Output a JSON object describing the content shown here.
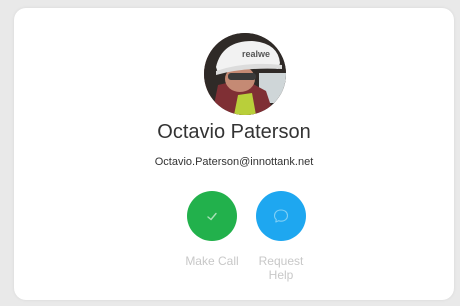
{
  "contact": {
    "name": "Octavio Paterson",
    "email": "Octavio.Paterson@innottank.net",
    "avatar_hat_text": "realwe"
  },
  "actions": {
    "call_label": "Make Call",
    "help_label": "Request\nHelp",
    "call_icon": "check-icon",
    "help_icon": "chat-bubble-icon"
  },
  "colors": {
    "call_button": "#22b14c",
    "help_button": "#1ea7f0",
    "label_text": "#c8c8c8"
  }
}
